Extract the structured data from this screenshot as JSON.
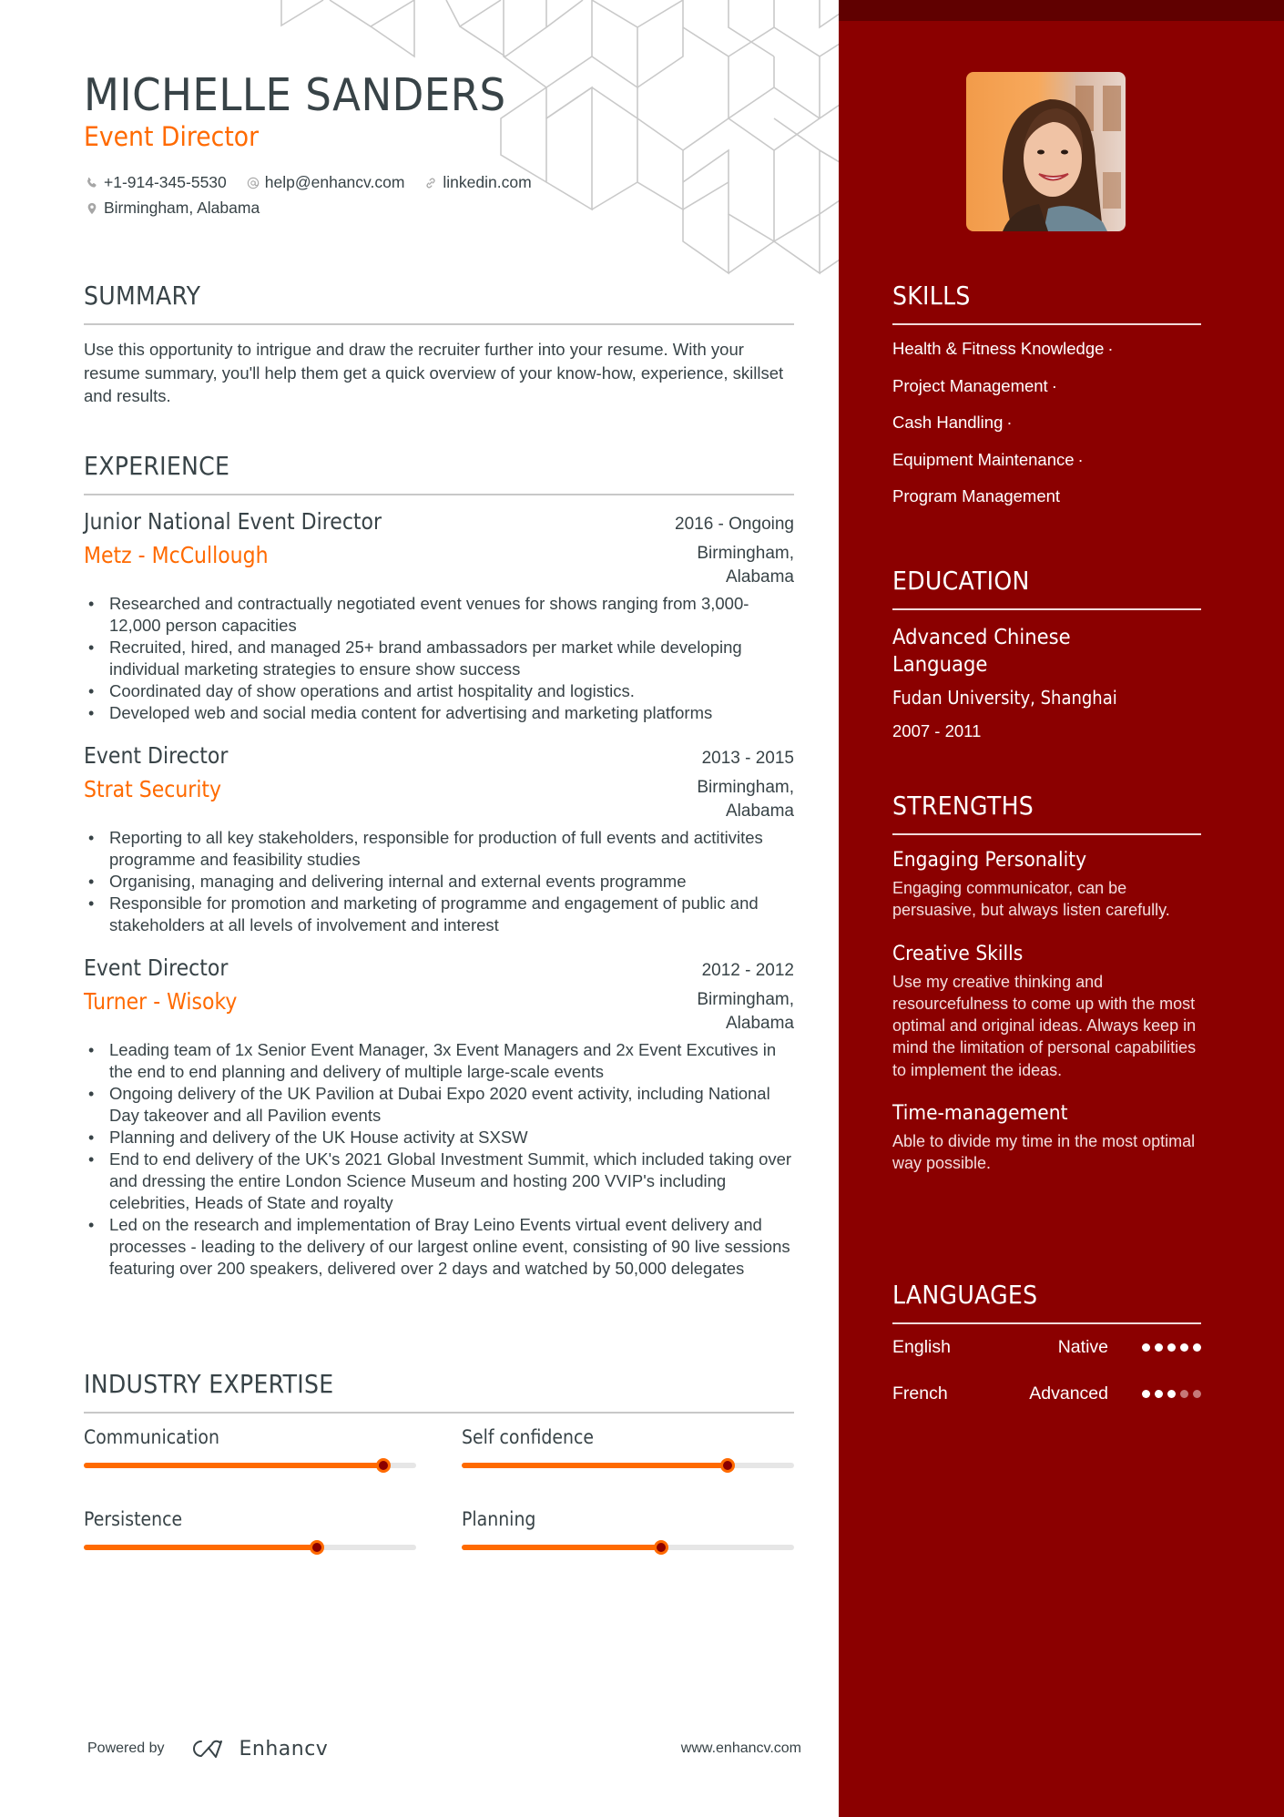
{
  "header": {
    "name": "MICHELLE SANDERS",
    "title": "Event Director",
    "contacts": [
      {
        "icon": "phone-icon",
        "text": "+1-914-345-5530"
      },
      {
        "icon": "at-icon",
        "text": "help@enhancv.com"
      },
      {
        "icon": "link-icon",
        "text": "linkedin.com"
      },
      {
        "icon": "location-pin-icon",
        "text": "Birmingham, Alabama"
      }
    ]
  },
  "summary": {
    "title": "SUMMARY",
    "text": "Use this opportunity to intrigue and draw the recruiter further into your resume. With your resume summary, you'll help them get a quick overview of your know-how, experience, skillset and results."
  },
  "experience": {
    "title": "EXPERIENCE",
    "jobs": [
      {
        "role": "Junior National Event Director",
        "dates": "2016 - Ongoing",
        "company": "Metz - McCullough",
        "location": "Birmingham, Alabama",
        "bullets": [
          "Researched and contractually negotiated event venues for shows ranging from 3,000-12,000 person capacities",
          "Recruited, hired, and managed 25+ brand ambassadors per market while developing individual marketing strategies to ensure show success",
          "Coordinated day of show operations and artist hospitality and logistics.",
          "Developed web and social media content for advertising and marketing platforms"
        ]
      },
      {
        "role": "Event Director",
        "dates": "2013 - 2015",
        "company": "Strat Security",
        "location": "Birmingham, Alabama",
        "bullets": [
          "Reporting to all key stakeholders, responsible for production of full events and actitivites programme and feasibility studies",
          "Organising, managing and delivering internal and external events programme",
          "Responsible for promotion and marketing of programme and engagement of public and stakeholders at all levels of involvement and interest"
        ]
      },
      {
        "role": "Event Director",
        "dates": "2012 - 2012",
        "company": "Turner - Wisoky",
        "location": "Birmingham, Alabama",
        "bullets": [
          "Leading team of 1x Senior Event Manager, 3x Event Managers and 2x Event Excutives in the end to end planning and delivery of multiple large-scale events",
          "Ongoing delivery of the UK Pavilion at Dubai Expo 2020 event activity, including National Day takeover and all Pavilion events",
          "Planning and delivery of the UK House activity at SXSW",
          "End to end delivery of the UK's 2021 Global Investment Summit, which included taking over and dressing the entire London Science Museum and hosting 200 VVIP's including celebrities, Heads of State and royalty",
          "Led on the research and implementation of Bray Leino Events virtual event delivery and processes - leading to the delivery of our largest online event, consisting of 90 live sessions featuring over 200 speakers, delivered over 2 days and watched by 50,000 delegates"
        ]
      }
    ]
  },
  "expertise": {
    "title": "INDUSTRY EXPERTISE",
    "items": [
      {
        "label": "Communication",
        "level_percent": 90
      },
      {
        "label": "Self confidence",
        "level_percent": 80
      },
      {
        "label": "Persistence",
        "level_percent": 70
      },
      {
        "label": "Planning",
        "level_percent": 60
      }
    ]
  },
  "footer": {
    "powered_by": "Powered by",
    "brand": "Enhancv",
    "website": "www.enhancv.com"
  },
  "sidebar": {
    "photo_alt": "Profile photo of Michelle Sanders",
    "skills": {
      "title": "SKILLS",
      "items": [
        "Health & Fitness Knowledge",
        "Project Management",
        "Cash Handling",
        "Equipment Maintenance",
        "Program Management"
      ],
      "separator": "·"
    },
    "education": {
      "title": "EDUCATION",
      "degree": "Advanced Chinese Language",
      "school": "Fudan University, Shanghai",
      "dates": "2007 - 2011"
    },
    "strengths": {
      "title": "STRENGTHS",
      "items": [
        {
          "title": "Engaging Personality",
          "description": "Engaging communicator, can be persuasive, but always listen carefully."
        },
        {
          "title": "Creative Skills",
          "description": "Use my creative thinking and resourcefulness to come up with the most optimal and original ideas. Always keep in mind the limitation of personal capabilities to implement the ideas."
        },
        {
          "title": "Time-management",
          "description": "Able to divide my time in the most optimal way possible."
        }
      ]
    },
    "languages": {
      "title": "LANGUAGES",
      "items": [
        {
          "name": "English",
          "level": "Native",
          "dots_filled": 5,
          "dots_total": 5
        },
        {
          "name": "French",
          "level": "Advanced",
          "dots_filled": 3,
          "dots_total": 5
        }
      ]
    }
  },
  "colors": {
    "accent": "#ff6a00",
    "sidebar_bg": "#8b0000",
    "sidebar_strip": "#600000",
    "text": "#384347",
    "rule": "#c8c8c8"
  }
}
